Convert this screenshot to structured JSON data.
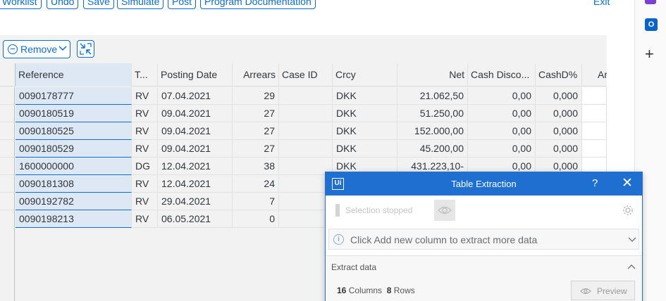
{
  "toolbar": {
    "buttons": [
      "Worklist",
      "Undo",
      "Save",
      "Simulate",
      "Post",
      "Program Documentation"
    ],
    "exit_label": "Exit"
  },
  "side_strip": {
    "outlook_letter": "O"
  },
  "grid_toolbar": {
    "remove_label": "Remove"
  },
  "table": {
    "columns": [
      "Reference",
      "T...",
      "Posting Date",
      "Arrears",
      "Case ID",
      "Crcy",
      "Net",
      "Cash Disco...",
      "CashD%",
      "Ar"
    ],
    "rows": [
      [
        "0090178777",
        "RV",
        "07.04.2021",
        "29",
        "",
        "DKK",
        "21.062,50",
        "0,00",
        "0,000"
      ],
      [
        "0090180519",
        "RV",
        "09.04.2021",
        "27",
        "",
        "DKK",
        "51.250,00",
        "0,00",
        "0,000"
      ],
      [
        "0090180525",
        "RV",
        "09.04.2021",
        "27",
        "",
        "DKK",
        "152.000,00",
        "0,00",
        "0,000"
      ],
      [
        "0090180529",
        "RV",
        "09.04.2021",
        "27",
        "",
        "DKK",
        "45.200,00",
        "0,00",
        "0,000"
      ],
      [
        "1600000000",
        "DG",
        "12.04.2021",
        "38",
        "",
        "DKK",
        "431.223,10-",
        "0,00",
        "0,000"
      ],
      [
        "0090181308",
        "RV",
        "12.04.2021",
        "24",
        "",
        "",
        "",
        "",
        ""
      ],
      [
        "0090192782",
        "RV",
        "29.04.2021",
        "7",
        "",
        "",
        "",
        "",
        ""
      ],
      [
        "0090198213",
        "RV",
        "06.05.2021",
        "0",
        "",
        "",
        "",
        "",
        ""
      ]
    ]
  },
  "dialog": {
    "logo": "Ui",
    "title": "Table Extraction",
    "help": "?",
    "close": "✕",
    "selection_status": "Selection stopped",
    "info_message": "Click Add new column to extract more data",
    "section_title": "Extract data",
    "columns_count": "16",
    "columns_label": "Columns",
    "rows_count": "8",
    "rows_label": "Rows",
    "preview_label": "Preview"
  },
  "colors": {
    "accent": "#0a6ed1",
    "uipath_blue": "#1f6fd1",
    "selection_blue": "#dde8f4"
  }
}
